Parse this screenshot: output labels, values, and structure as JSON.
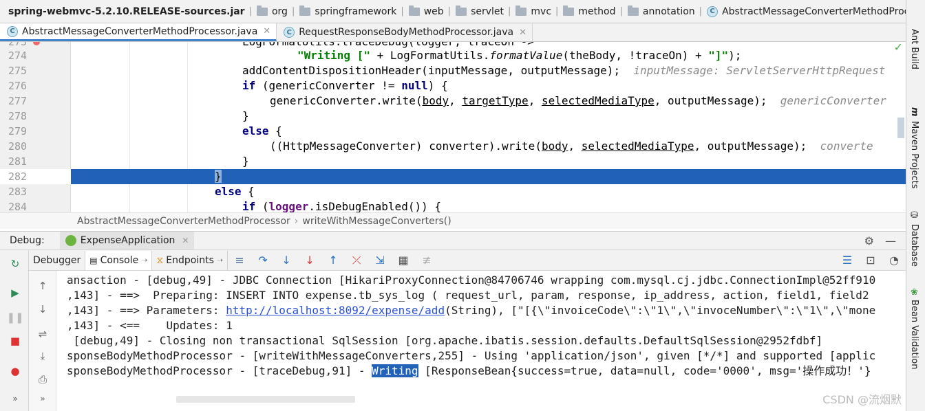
{
  "navbar": {
    "jar": "spring-webmvc-5.2.10.RELEASE-sources.jar",
    "crumbs": [
      "org",
      "springframework",
      "web",
      "servlet",
      "mvc",
      "method",
      "annotation"
    ],
    "class_name": "AbstractMessageConverterMethodProcessor"
  },
  "tabs": [
    {
      "label": "AbstractMessageConverterMethodProcessor.java",
      "active": true
    },
    {
      "label": "RequestResponseBodyMethodProcessor.java",
      "active": false
    }
  ],
  "editor": {
    "line_numbers": [
      "273",
      "274",
      "275",
      "276",
      "277",
      "278",
      "279",
      "280",
      "281",
      "282",
      "283",
      "284"
    ],
    "line_273": "LogFormatUtils.traceDebug(logger, traceOn ->",
    "line_274_str": "\"Writing [\"",
    "line_274_mid": " + LogFormatUtils.",
    "line_274_call": "formatValue",
    "line_274_rest": "(theBody, !traceOn) + ",
    "line_274_end": "\"]\"",
    "line_274_tail": ");",
    "line_275": "addContentDispositionHeader(inputMessage, outputMessage);",
    "line_275_hint": "inputMessage: ServletServerHttpRequest",
    "line_276_kw": "if",
    "line_276_mid": " (genericConverter != ",
    "line_276_null": "null",
    "line_276_end": ") {",
    "line_277_pre": "genericConverter.write(",
    "line_277_a": "body",
    "line_277_b": "targetType",
    "line_277_c": "selectedMediaType",
    "line_277_end": ", outputMessage);",
    "line_277_hint": "genericConverter",
    "line_278": "}",
    "line_279_kw": "else",
    "line_279_end": " {",
    "line_280_pre": "((HttpMessageConverter) converter).write(",
    "line_280_a": "body",
    "line_280_b": "selectedMediaType",
    "line_280_end": ", outputMessage);",
    "line_280_hint": "converte",
    "line_281": "}",
    "line_282": "}",
    "line_283_kw": "else",
    "line_283_end": " {",
    "line_284_kw": "if",
    "line_284_mid": " (",
    "line_284_fld": "logger",
    "line_284_end": ".isDebugEnabled()) {"
  },
  "editor_breadcrumb": {
    "class": "AbstractMessageConverterMethodProcessor",
    "method": "writeWithMessageConverters()"
  },
  "debug": {
    "label": "Debug:",
    "session": "ExpenseApplication",
    "tabs": [
      "Debugger",
      "Console",
      "Endpoints"
    ]
  },
  "console": {
    "line1": "ansaction - [debug,49] - JDBC Connection [HikariProxyConnection@84706746 wrapping com.mysql.cj.jdbc.ConnectionImpl@52ff910",
    "line2": ",143] - ==>  Preparing: INSERT INTO expense.tb_sys_log ( request_url, param, response, ip_address, action, field1, field2",
    "line3_pre": ",143] - ==> Parameters: ",
    "line3_link": "http://localhost:8092/expense/add",
    "line3_post": "(String), [\"[{\\\"invoiceCode\\\":\\\"1\\\",\\\"invoceNumber\\\":\\\"1\\\",\\\"mone",
    "line4": ",143] - <==    Updates: 1",
    "line5": " [debug,49] - Closing non transactional SqlSession [org.apache.ibatis.session.defaults.DefaultSqlSession@2952fdbf]",
    "line6": "sponseBodyMethodProcessor - [writeWithMessageConverters,255] - Using 'application/json', given [*/*] and supported [applic",
    "line7_pre": "sponseBodyMethodProcessor - [traceDebug,91] - ",
    "line7_sel": "Writing",
    "line7_post": " [ResponseBean{success=true, data=null, code='0000', msg='操作成功！'}"
  },
  "right_strip": [
    "Ant Build",
    "Maven Projects",
    "Database",
    "Bean Validation"
  ],
  "watermark": "CSDN @流烟默",
  "colors": {
    "selection": "#2162b8",
    "keyword": "#000080",
    "string": "#008000",
    "field": "#660e7a",
    "link": "#2a4fd8"
  }
}
